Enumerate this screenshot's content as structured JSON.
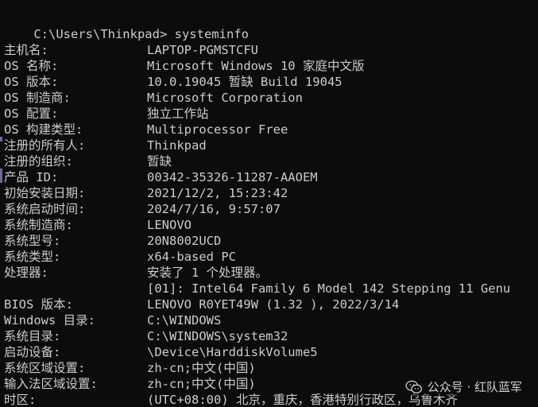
{
  "prompt": {
    "path": "C:\\Users\\Thinkpad>",
    "command": " systeminfo"
  },
  "rows": [
    {
      "key": "主机名:",
      "value": "LAPTOP-PGMSTCFU"
    },
    {
      "key": "OS 名称:",
      "value": "Microsoft Windows 10 家庭中文版"
    },
    {
      "key": "OS 版本:",
      "value": "10.0.19045 暂缺 Build 19045"
    },
    {
      "key": "OS 制造商:",
      "value": "Microsoft Corporation"
    },
    {
      "key": "OS 配置:",
      "value": "独立工作站"
    },
    {
      "key": "OS 构建类型:",
      "value": "Multiprocessor Free"
    },
    {
      "key": "注册的所有人:",
      "value": "Thinkpad"
    },
    {
      "key": "注册的组织:",
      "value": "暂缺"
    },
    {
      "key": "产品 ID:",
      "value": "00342-35326-11287-AAOEM"
    },
    {
      "key": "初始安装日期:",
      "value": "2021/12/2, 15:23:42"
    },
    {
      "key": "系统启动时间:",
      "value": "2024/7/16, 9:57:07"
    },
    {
      "key": "系统制造商:",
      "value": "LENOVO"
    },
    {
      "key": "系统型号:",
      "value": "20N8002UCD"
    },
    {
      "key": "系统类型:",
      "value": "x64-based PC"
    },
    {
      "key": "处理器:",
      "value": "安装了 1 个处理器。"
    },
    {
      "key": "",
      "value": "[01]: Intel64 Family 6 Model 142 Stepping 11 Genu"
    },
    {
      "key": "BIOS 版本:",
      "value": "LENOVO R0YET49W (1.32 ), 2022/3/14"
    },
    {
      "key": "Windows 目录:",
      "value": "C:\\WINDOWS"
    },
    {
      "key": "系统目录:",
      "value": "C:\\WINDOWS\\system32"
    },
    {
      "key": "启动设备:",
      "value": "\\Device\\HarddiskVolume5"
    },
    {
      "key": "系统区域设置:",
      "value": "zh-cn;中文(中国)"
    },
    {
      "key": "输入法区域设置:",
      "value": "zh-cn;中文(中国)"
    },
    {
      "key": "时区:",
      "value": "(UTC+08:00) 北京，重庆，香港特别行政区，乌鲁木齐"
    }
  ],
  "watermark": {
    "icon": "wechat-icon",
    "text": "公众号 · 红队蓝军"
  },
  "colors": {
    "background": "#0c0c0c",
    "foreground": "#cccccc"
  }
}
